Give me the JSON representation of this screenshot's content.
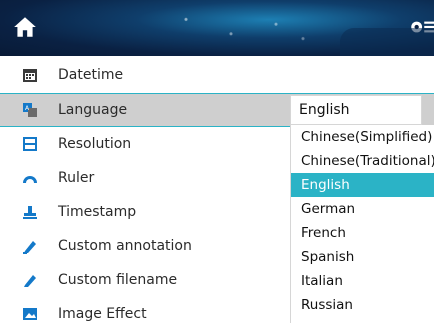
{
  "menu": {
    "items": [
      {
        "label": "Datetime",
        "icon": "calendar-icon"
      },
      {
        "label": "Language",
        "icon": "language-icon"
      },
      {
        "label": "Resolution",
        "icon": "resolution-icon"
      },
      {
        "label": "Ruler",
        "icon": "ruler-icon"
      },
      {
        "label": "Timestamp",
        "icon": "timestamp-icon"
      },
      {
        "label": "Custom annotation",
        "icon": "pen-icon"
      },
      {
        "label": "Custom filename",
        "icon": "pen-icon"
      },
      {
        "label": "Image Effect",
        "icon": "image-effect-icon"
      }
    ]
  },
  "language_select": {
    "selected": "English",
    "options": [
      "Chinese(Simplified)",
      "Chinese(Traditional)",
      "English",
      "German",
      "French",
      "Spanish",
      "Italian",
      "Russian"
    ]
  },
  "colors": {
    "accent": "#2bb3c6",
    "header_dark": "#0a2143",
    "icon_blue": "#1479c9",
    "row_selected_bg": "#cfcfcf"
  }
}
